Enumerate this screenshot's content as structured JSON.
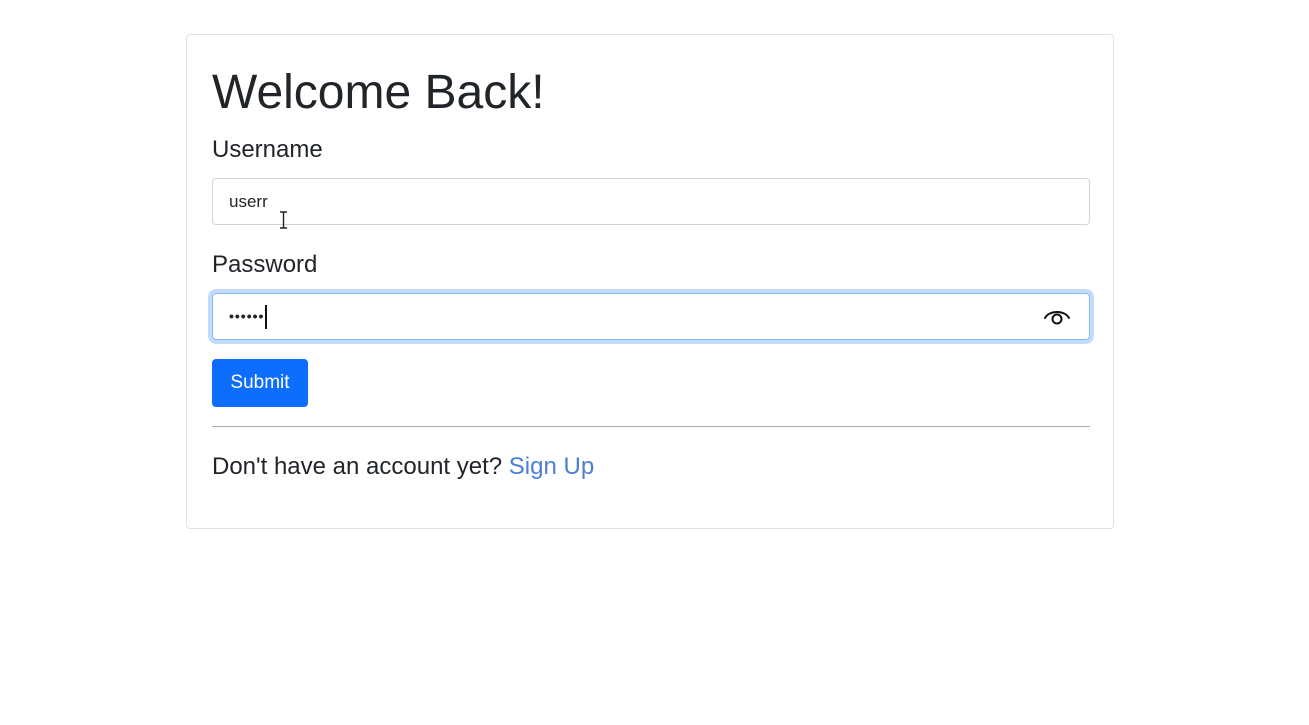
{
  "form": {
    "title": "Welcome Back!",
    "username": {
      "label": "Username",
      "value": "userr"
    },
    "password": {
      "label": "Password",
      "masked_value": "••••••"
    },
    "toggle_visibility_icon": "eye-icon",
    "submit_label": "Submit",
    "footer": {
      "prompt": "Don't have an account yet?",
      "link_label": "Sign Up"
    }
  },
  "colors": {
    "primary": "#0d6efd",
    "link": "#4b7fd6",
    "focus_border": "#86b7fe"
  }
}
